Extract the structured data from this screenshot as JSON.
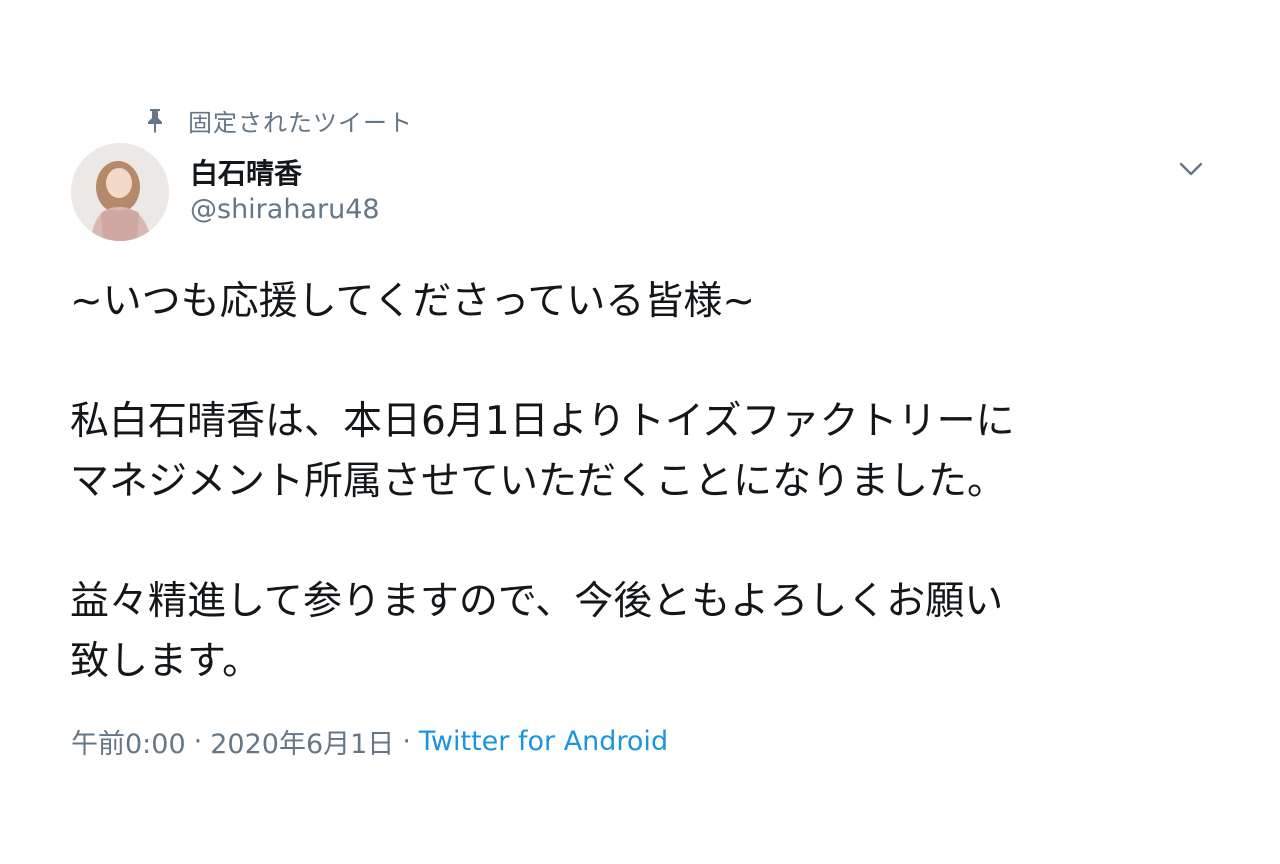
{
  "pinned": {
    "label": "固定されたツイート",
    "icon": "pin-icon"
  },
  "author": {
    "display_name": "白石晴香",
    "handle": "@shiraharu48",
    "avatar_icon": "avatar"
  },
  "menu": {
    "icon": "chevron-down-icon"
  },
  "tweet": {
    "lines": [
      "~いつも応援してくださっている皆様~",
      "私白石晴香は、本日6月1日よりトイズファクトリーに",
      "マネジメント所属させていただくことになりました。",
      "益々精進して参りますので、今後ともよろしくお願い",
      "致します。"
    ]
  },
  "meta": {
    "time": "午前0:00",
    "separator": "·",
    "date": "2020年6月1日",
    "source": "Twitter for Android"
  },
  "colors": {
    "text": "#14171a",
    "secondary": "#657786",
    "link": "#1b95e0",
    "background": "#ffffff"
  }
}
